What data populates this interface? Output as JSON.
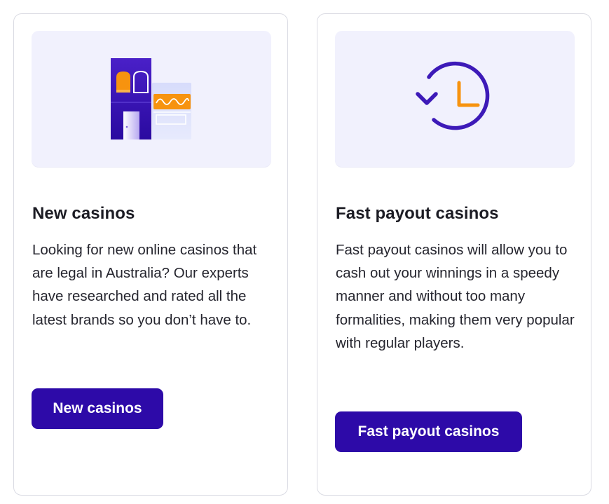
{
  "cards": [
    {
      "title": "New casinos",
      "description": "Looking for new online casinos that are legal in Australia? Our experts have researched and rated all the latest brands so you don’t have to.",
      "button_label": "New casinos",
      "illustration_icon": "casino-building-icon"
    },
    {
      "title": "Fast payout casinos",
      "description": "Fast payout casinos will allow you to cash out your winnings in a speedy manner and without too many formalities, making them very popular with regular players.",
      "button_label": "Fast payout casinos",
      "illustration_icon": "clock-rewind-icon"
    }
  ],
  "colors": {
    "button_bg": "#2d0aa8",
    "illustration_bg": "#f1f1fd",
    "accent_orange": "#f7930f",
    "accent_purple": "#3d1ab8"
  }
}
